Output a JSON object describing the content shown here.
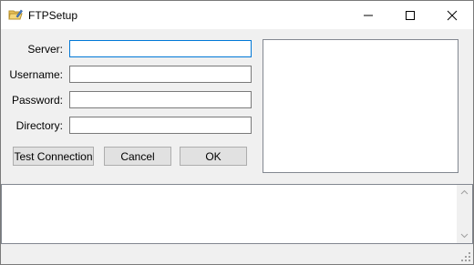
{
  "window": {
    "title": "FTPSetup",
    "icon": "folder-pencil-icon"
  },
  "titlebar_buttons": [
    "minimize-icon",
    "maximize-icon",
    "close-icon"
  ],
  "form": {
    "server_label": "Server:",
    "server_value": "",
    "username_label": "Username:",
    "username_value": "",
    "password_label": "Password:",
    "password_value": "",
    "directory_label": "Directory:",
    "directory_value": ""
  },
  "buttons": {
    "test_connection": "Test Connection",
    "cancel": "Cancel",
    "ok": "OK"
  },
  "colors": {
    "focus_border": "#0078d7",
    "window_bg": "#f0f0f0",
    "button_bg": "#e1e1e1"
  }
}
